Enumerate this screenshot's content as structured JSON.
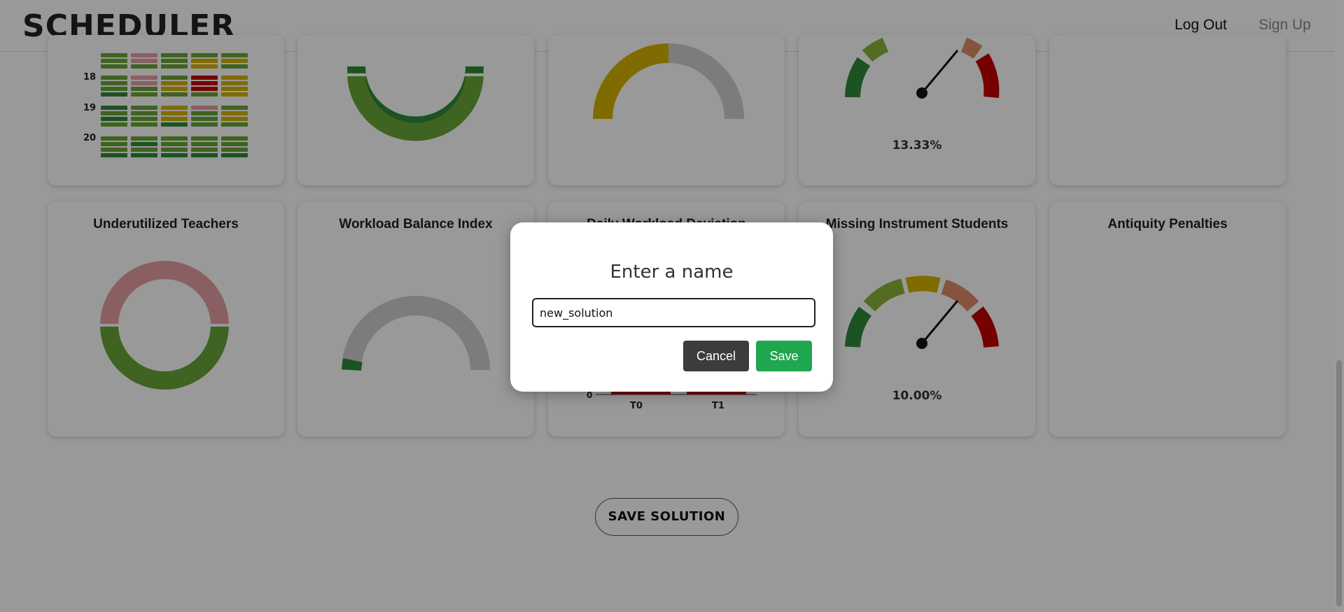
{
  "header": {
    "logo": "SCHEDULER",
    "logout_label": "Log Out",
    "signup_label": "Sign Up"
  },
  "heatmap": {
    "row_labels": [
      "18",
      "19",
      "20"
    ]
  },
  "cards_top": {
    "gauge_value": "13.33%"
  },
  "cards_bottom": [
    {
      "title": "Underutilized Teachers"
    },
    {
      "title": "Workload Balance Index"
    },
    {
      "title": "Daily Workload Deviation",
      "y_tick": "0",
      "x_ticks": [
        "T0",
        "T1"
      ]
    },
    {
      "title": "Missing Instrument Students",
      "gauge_value": "10.00%"
    },
    {
      "title": "Antiquity Penalties"
    }
  ],
  "save_solution_label": "SAVE SOLUTION",
  "modal": {
    "title": "Enter a name",
    "input_value": "new_solution",
    "cancel_label": "Cancel",
    "save_label": "Save"
  },
  "colors": {
    "green_dark": "#2e8b3a",
    "green": "#6aa536",
    "yellow": "#d6b200",
    "pink": "#e79ea3",
    "red": "#c40000",
    "salmon": "#e08a6a",
    "grey_arc": "#cfcfcf",
    "save_green": "#1fa74f"
  }
}
